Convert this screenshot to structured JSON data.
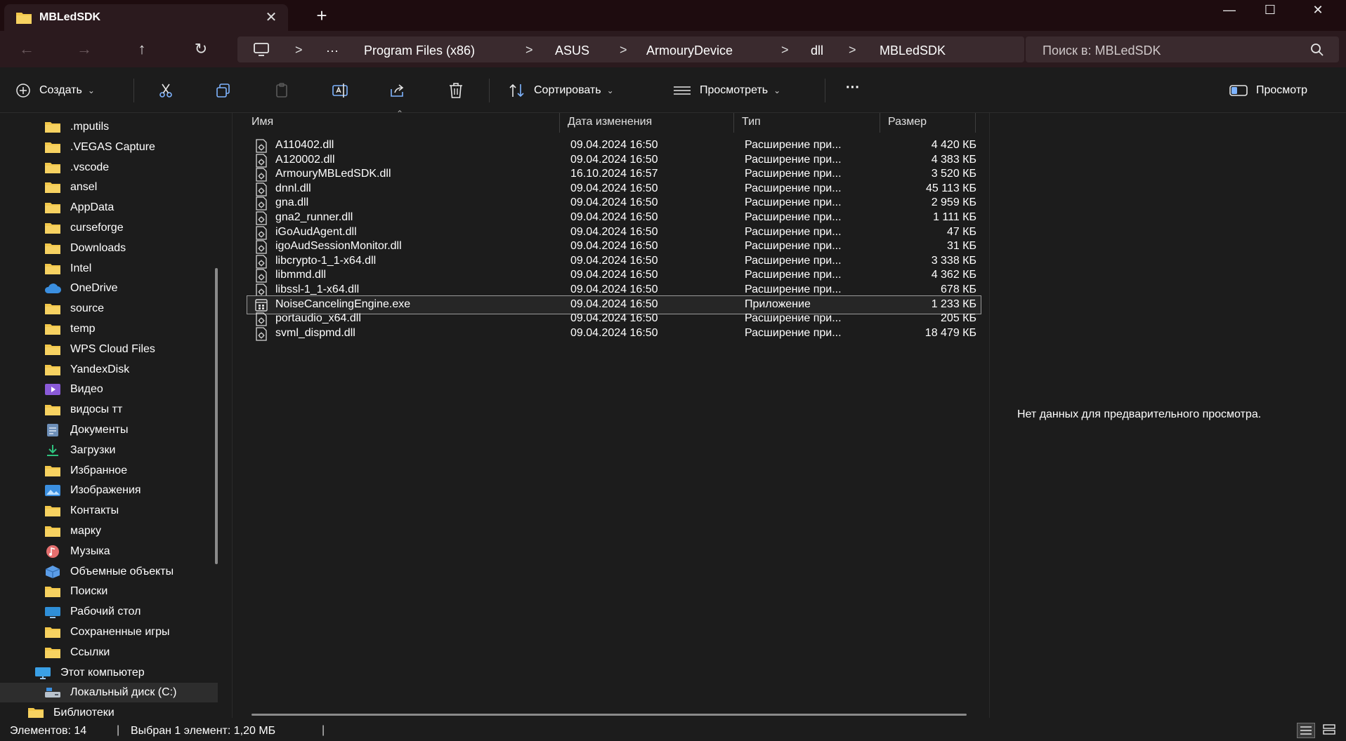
{
  "window": {
    "tab_title": "MBLedSDK",
    "close_tab": "✕",
    "new_tab": "+",
    "minimize": "—",
    "maximize": "☐",
    "close": "✕"
  },
  "nav": {
    "back": "←",
    "forward": "→",
    "up": "↑",
    "refresh": "↻",
    "more_crumbs": "···",
    "crumbs": [
      "Program Files (x86)",
      "ASUS",
      "ArmouryDevice",
      "dll",
      "MBLedSDK"
    ],
    "separator": ">",
    "search_placeholder": "Поиск в: MBLedSDK"
  },
  "toolbar": {
    "create": "Создать",
    "sort": "Сортировать",
    "view": "Просмотреть",
    "more": "···",
    "preview": "Просмотр"
  },
  "sidebar": {
    "items": [
      {
        "label": ".mputils",
        "icon": "folder-icon"
      },
      {
        "label": ".VEGAS Capture",
        "icon": "folder-icon"
      },
      {
        "label": ".vscode",
        "icon": "folder-icon"
      },
      {
        "label": "ansel",
        "icon": "folder-icon"
      },
      {
        "label": "AppData",
        "icon": "folder-icon"
      },
      {
        "label": "curseforge",
        "icon": "folder-icon"
      },
      {
        "label": "Downloads",
        "icon": "folder-icon"
      },
      {
        "label": "Intel",
        "icon": "folder-icon"
      },
      {
        "label": "OneDrive",
        "icon": "cloud-icon"
      },
      {
        "label": "source",
        "icon": "folder-icon"
      },
      {
        "label": "temp",
        "icon": "folder-icon"
      },
      {
        "label": "WPS Cloud Files",
        "icon": "folder-icon"
      },
      {
        "label": "YandexDisk",
        "icon": "folder-icon"
      },
      {
        "label": "Видео",
        "icon": "video-icon"
      },
      {
        "label": "видосы тт",
        "icon": "folder-icon"
      },
      {
        "label": "Документы",
        "icon": "document-icon"
      },
      {
        "label": "Загрузки",
        "icon": "download-icon"
      },
      {
        "label": "Избранное",
        "icon": "folder-icon"
      },
      {
        "label": "Изображения",
        "icon": "pictures-icon"
      },
      {
        "label": "Контакты",
        "icon": "folder-icon"
      },
      {
        "label": "марку",
        "icon": "folder-icon"
      },
      {
        "label": "Музыка",
        "icon": "music-icon"
      },
      {
        "label": "Объемные объекты",
        "icon": "cube-icon"
      },
      {
        "label": "Поиски",
        "icon": "folder-icon"
      },
      {
        "label": "Рабочий стол",
        "icon": "desktop-icon"
      },
      {
        "label": "Сохраненные игры",
        "icon": "folder-icon"
      },
      {
        "label": "Ссылки",
        "icon": "folder-icon"
      },
      {
        "label": "Этот компьютер",
        "icon": "computer-icon"
      },
      {
        "label": "Локальный диск (C:)",
        "icon": "drive-icon"
      },
      {
        "label": "Библиотеки",
        "icon": "folder-icon"
      }
    ]
  },
  "columns": {
    "name": "Имя",
    "date": "Дата изменения",
    "type": "Тип",
    "size": "Размер"
  },
  "files": [
    {
      "name": "A110402.dll",
      "date": "09.04.2024 16:50",
      "type": "Расширение при...",
      "size": "4 420 КБ"
    },
    {
      "name": "A120002.dll",
      "date": "09.04.2024 16:50",
      "type": "Расширение при...",
      "size": "4 383 КБ"
    },
    {
      "name": "ArmouryMBLedSDK.dll",
      "date": "16.10.2024 16:57",
      "type": "Расширение при...",
      "size": "3 520 КБ"
    },
    {
      "name": "dnnl.dll",
      "date": "09.04.2024 16:50",
      "type": "Расширение при...",
      "size": "45 113 КБ"
    },
    {
      "name": "gna.dll",
      "date": "09.04.2024 16:50",
      "type": "Расширение при...",
      "size": "2 959 КБ"
    },
    {
      "name": "gna2_runner.dll",
      "date": "09.04.2024 16:50",
      "type": "Расширение при...",
      "size": "1 111 КБ"
    },
    {
      "name": "iGoAudAgent.dll",
      "date": "09.04.2024 16:50",
      "type": "Расширение при...",
      "size": "47 КБ"
    },
    {
      "name": "igoAudSessionMonitor.dll",
      "date": "09.04.2024 16:50",
      "type": "Расширение при...",
      "size": "31 КБ"
    },
    {
      "name": "libcrypto-1_1-x64.dll",
      "date": "09.04.2024 16:50",
      "type": "Расширение при...",
      "size": "3 338 КБ"
    },
    {
      "name": "libmmd.dll",
      "date": "09.04.2024 16:50",
      "type": "Расширение при...",
      "size": "4 362 КБ"
    },
    {
      "name": "libssl-1_1-x64.dll",
      "date": "09.04.2024 16:50",
      "type": "Расширение при...",
      "size": "678 КБ"
    },
    {
      "name": "NoiseCancelingEngine.exe",
      "date": "09.04.2024 16:50",
      "type": "Приложение",
      "size": "1 233 КБ",
      "selected": true,
      "kind": "exe"
    },
    {
      "name": "portaudio_x64.dll",
      "date": "09.04.2024 16:50",
      "type": "Расширение при...",
      "size": "205 КБ"
    },
    {
      "name": "svml_dispmd.dll",
      "date": "09.04.2024 16:50",
      "type": "Расширение при...",
      "size": "18 479 КБ"
    }
  ],
  "preview": {
    "message": "Нет данных для предварительного просмотра."
  },
  "status": {
    "count": "Элементов: 14",
    "selection": "Выбран 1 элемент: 1,20 МБ",
    "divider": "|"
  },
  "colors": {
    "titlebar": "#1e0c0f",
    "navbar": "#2b1a1e",
    "folder": "#f2c74a",
    "background": "#1c1c1c"
  }
}
